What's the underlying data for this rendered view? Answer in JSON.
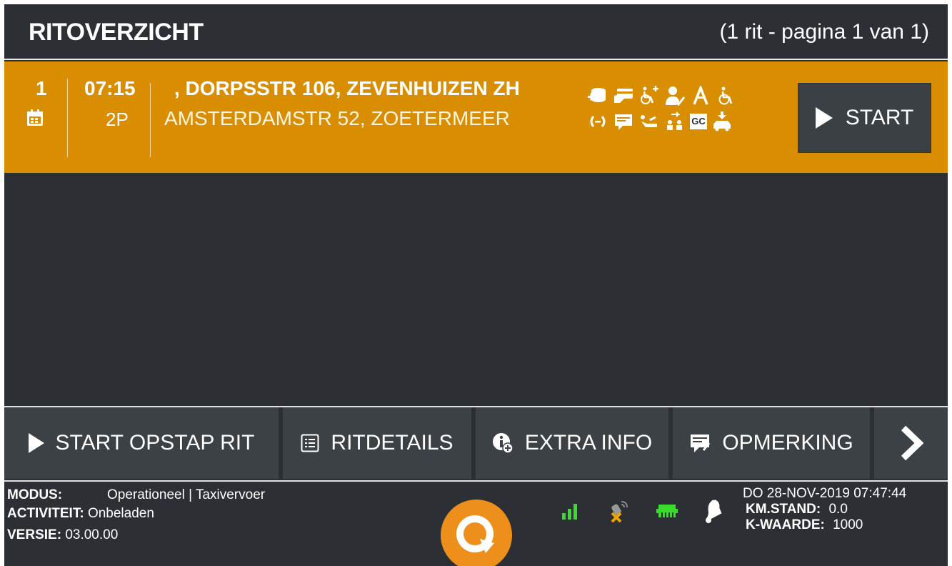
{
  "header": {
    "title": "RITOVERZICHT",
    "page_info": "(1 rit - pagina 1 van 1)"
  },
  "ride": {
    "number": "1",
    "calendar_icon": "calendar-icon",
    "time": "07:15",
    "passengers": "2P",
    "pickup": ", DORPSSTR 106, ZEVENHUIZEN ZH",
    "dropoff": "AMSTERDAMSTR 52, ZOETERMEER",
    "attribute_icons_row1": [
      "coins-plus-icon",
      "card-payment-icon",
      "wheelchair-plus-icon",
      "person-check-icon",
      "walker-icon",
      "wheelchair-icon"
    ],
    "attribute_icons_row2": [
      "phone-connect-icon",
      "note-icon",
      "reclining-seat-icon",
      "group-transfer-icon",
      "gc-badge-icon",
      "car-pickup-icon"
    ],
    "gc_label": "GC",
    "start_label": "START",
    "background": "#d98d00"
  },
  "actions": {
    "start_pickup": "START OPSTAP RIT",
    "ride_details": "RITDETAILS",
    "extra_info": "EXTRA INFO",
    "remark": "OPMERKING"
  },
  "footer": {
    "mode_label": "MODUS:",
    "mode_value": "Operationeel | Taxivervoer",
    "activity_label": "ACTIVITEIT:",
    "activity_value": "Onbeladen",
    "version_label": "VERSIE:",
    "version_value": "03.00.00",
    "datetime": "DO 28-NOV-2019 07:47:44",
    "km_label": "KM.STAND:",
    "km_value": "0.0",
    "k_label": "K-WAARDE:",
    "k_value": "1000",
    "status_icons": [
      "signal-bars-icon",
      "gps-off-icon",
      "network-icon",
      "bell-icon"
    ]
  },
  "colors": {
    "background": "#2c2f33",
    "accent": "#d98d00",
    "button": "#3c4145",
    "status_green": "#3adb2c",
    "logo_orange": "#ee8f1c"
  }
}
